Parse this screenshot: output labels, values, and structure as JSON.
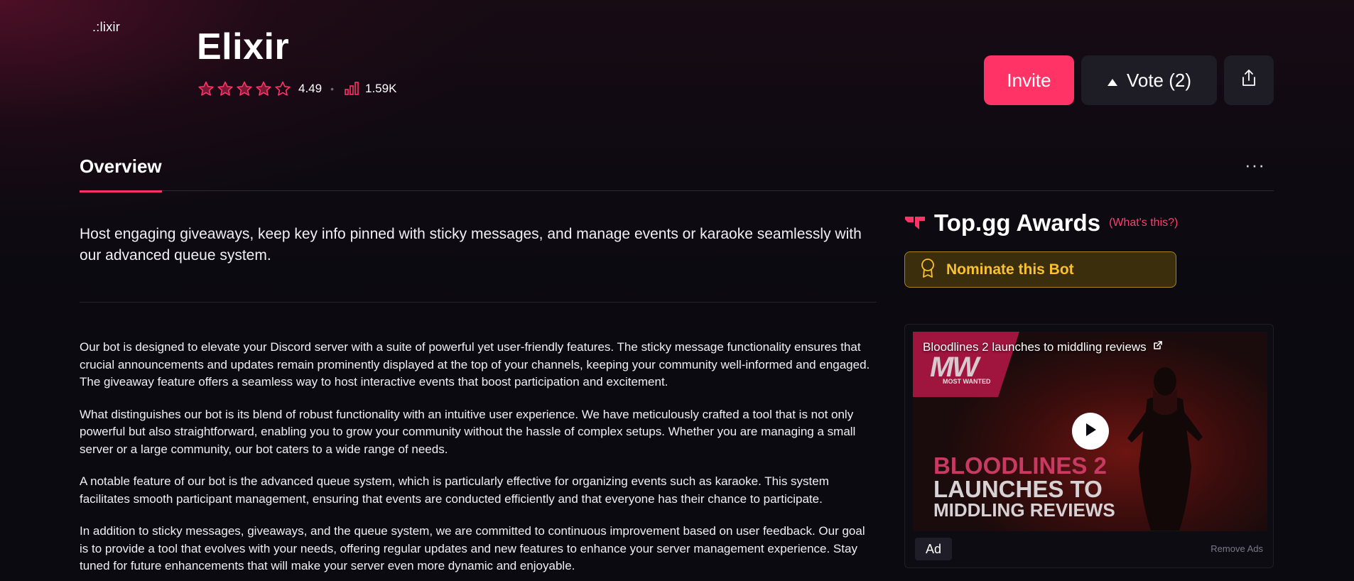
{
  "bot": {
    "logo_text": ".:lixir",
    "name": "Elixir",
    "rating": "4.49",
    "rating_value": 4.49,
    "stat": "1.59K"
  },
  "actions": {
    "invite_label": "Invite",
    "vote_label": "Vote (2)"
  },
  "tabs": {
    "overview": "Overview",
    "more": "···"
  },
  "summary": "Host engaging giveaways, keep key info pinned with sticky messages, and manage events or karaoke seamlessly with our advanced queue system.",
  "description": [
    "Our bot is designed to elevate your Discord server with a suite of powerful yet user-friendly features. The sticky message functionality ensures that crucial announcements and updates remain prominently displayed at the top of your channels, keeping your community well-informed and engaged. The giveaway feature offers a seamless way to host interactive events that boost participation and excitement.",
    "What distinguishes our bot is its blend of robust functionality with an intuitive user experience. We have meticulously crafted a tool that is not only powerful but also straightforward, enabling you to grow your community without the hassle of complex setups. Whether you are managing a small server or a large community, our bot caters to a wide range of needs.",
    "A notable feature of our bot is the advanced queue system, which is particularly effective for organizing events such as karaoke. This system facilitates smooth participant management, ensuring that events are conducted efficiently and that everyone has their chance to participate.",
    "In addition to sticky messages, giveaways, and the queue system, we are committed to continuous improvement based on user feedback. Our goal is to provide a tool that evolves with your needs, offering regular updates and new features to enhance your server management experience. Stay tuned for future enhancements that will make your server even more dynamic and enjoyable."
  ],
  "awards": {
    "title": "Top.gg Awards",
    "help_link": "(What's this?)",
    "nominate_label": "Nominate this Bot"
  },
  "ad": {
    "headline": "Bloodlines 2 launches to middling reviews",
    "banner_mark": "MW",
    "banner_text": "MOST WANTED",
    "big_line_1": "BLOODLINES 2",
    "big_line_2": "LAUNCHES TO",
    "big_line_3": "MIDDLING REVIEWS",
    "tag": "Ad",
    "remove_label": "Remove Ads"
  },
  "icons": {
    "star": "star-icon",
    "stat": "bar-chart-icon",
    "vote": "caret-up-icon",
    "share": "share-icon",
    "awards": "topgg-logo-icon",
    "nominate": "award-ribbon-icon",
    "play": "play-icon",
    "external": "external-link-icon"
  },
  "colors": {
    "accent": "#ff3366",
    "background": "#0b0a10",
    "button_dark": "#1e1d26",
    "nominate_text": "#fbc02d",
    "nominate_bg": "#3a2e0d"
  }
}
